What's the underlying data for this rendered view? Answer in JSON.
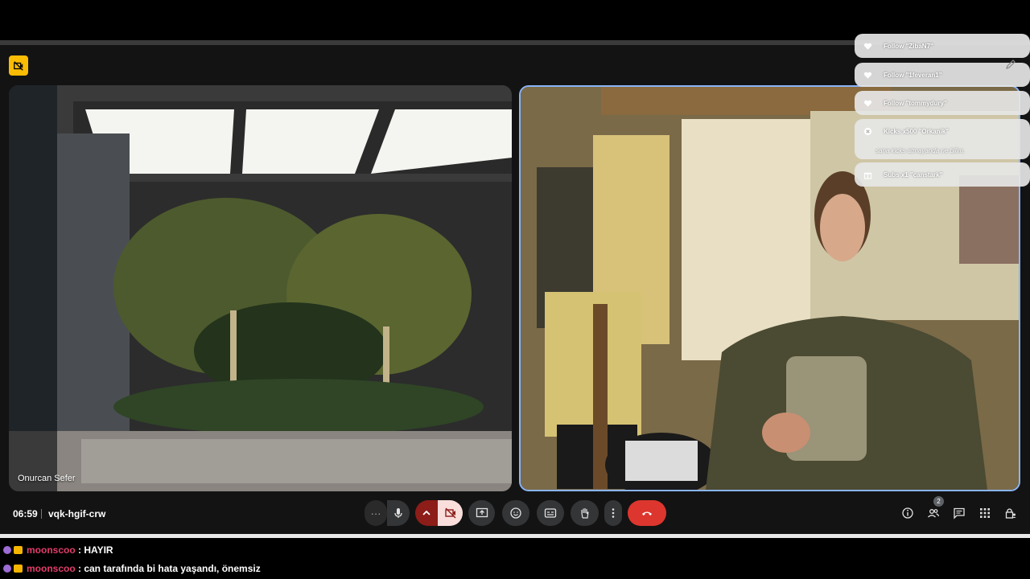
{
  "meeting": {
    "time": "06:59",
    "code": "vqk-hgif-crw",
    "participant_count": "2",
    "more_label": "···"
  },
  "tiles": [
    {
      "name": "Onurcan Sefer"
    }
  ],
  "notifications": [
    {
      "icon": "heart-icon",
      "prefix": "Follow ",
      "name": "\"ZibaN7\""
    },
    {
      "icon": "heart-icon",
      "prefix": "Follow ",
      "name": "\"1feveran1\""
    },
    {
      "icon": "heart-icon",
      "prefix": "Follow ",
      "name": "\"tommydury\""
    },
    {
      "icon": "close-circle-icon",
      "prefix": "Kicks x500 ",
      "name": "\"Orkanik\"",
      "message": "sana kicks atmayanda ne bilim."
    },
    {
      "icon": "gift-icon",
      "prefix": "Subs x1 ",
      "name": "\"canstark\""
    }
  ],
  "chat": [
    {
      "user": "moonscoo",
      "text": " : HAYIR"
    },
    {
      "user": "moonscoo",
      "text": " : can tarafında bi hata yaşandı, önemsiz"
    }
  ],
  "colors": {
    "leave_button": "#dc362e",
    "cam_off_bg": "#f9dedc",
    "active_border": "#8ab4f8",
    "chat_user": "#e23d6a",
    "pin_badge": "#fbbc04"
  }
}
